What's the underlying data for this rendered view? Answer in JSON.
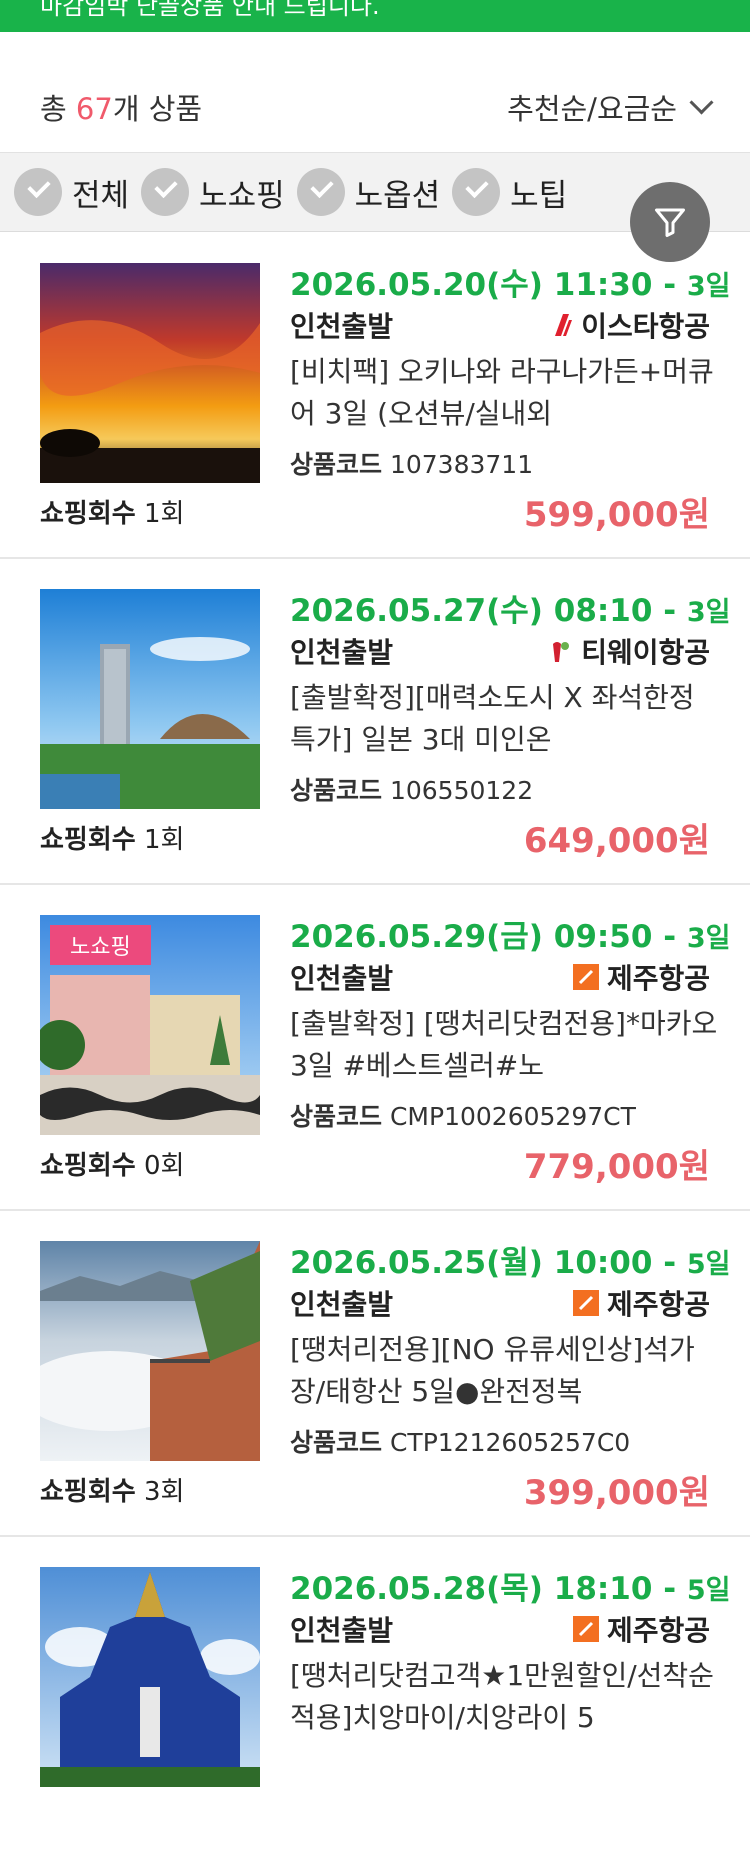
{
  "banner": {
    "text": "마감임박 단골상품 안내 드립니다."
  },
  "summary": {
    "prefix": "총 ",
    "count": "67",
    "suffix": "개 상품",
    "sort_label": "추천순/요금순"
  },
  "filters": [
    {
      "label": "전체"
    },
    {
      "label": "노쇼핑"
    },
    {
      "label": "노옵션"
    },
    {
      "label": "노팁"
    }
  ],
  "labels": {
    "code_label": "상품코드",
    "shop_label": "쇼핑회수"
  },
  "products": [
    {
      "date": "2026.05.20(수) 11:30",
      "duration": "3일",
      "departure": "인천출발",
      "airline": "이스타항공",
      "airline_icon": "eastar-logo-icon",
      "title": "[비치팩] 오키나와 라구나가든+머큐어 3일 (오션뷰/실내외",
      "code": "107383711",
      "shopping": "1회",
      "price": "599,000원",
      "badge": ""
    },
    {
      "date": "2026.05.27(수) 08:10",
      "duration": "3일",
      "departure": "인천출발",
      "airline": "티웨이항공",
      "airline_icon": "tway-logo-icon",
      "title": "[출발확정][매력소도시 X 좌석한정특가] 일본 3대 미인온",
      "code": "106550122",
      "shopping": "1회",
      "price": "649,000원",
      "badge": ""
    },
    {
      "date": "2026.05.29(금) 09:50",
      "duration": "3일",
      "departure": "인천출발",
      "airline": "제주항공",
      "airline_icon": "jejuair-logo-icon",
      "title": "[출발확정] [땡처리닷컴전용]*마카오 3일 #베스트셀러#노",
      "code": "CMP1002605297CT",
      "shopping": "0회",
      "price": "779,000원",
      "badge": "노쇼핑"
    },
    {
      "date": "2026.05.25(월) 10:00",
      "duration": "5일",
      "departure": "인천출발",
      "airline": "제주항공",
      "airline_icon": "jejuair-logo-icon",
      "title": "[땡처리전용][NO 유류세인상]석가장/태항산 5일●완전정복",
      "code": "CTP1212605257C0",
      "shopping": "3회",
      "price": "399,000원",
      "badge": ""
    },
    {
      "date": "2026.05.28(목) 18:10",
      "duration": "5일",
      "departure": "인천출발",
      "airline": "제주항공",
      "airline_icon": "jejuair-logo-icon",
      "title": "[땡처리닷컴고객★1만원할인/선착순적용]치앙마이/치앙라이 5",
      "code": "",
      "shopping": "",
      "price": "",
      "badge": ""
    }
  ],
  "colors": {
    "green": "#1aac49",
    "price": "#e8636a",
    "badge": "#ec4a7d"
  }
}
